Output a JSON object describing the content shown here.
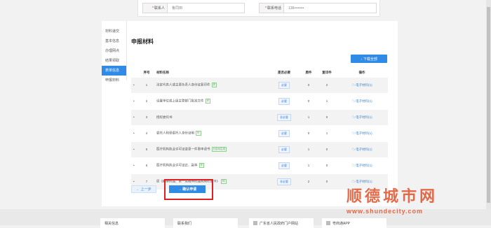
{
  "contact": {
    "person_label": "联系人",
    "person_value": "鲁同田",
    "phone_label": "联系电话",
    "phone_value": "138••••••••"
  },
  "steps": [
    {
      "label": "材料递交"
    },
    {
      "label": "基本信息"
    },
    {
      "label": "办理网点"
    },
    {
      "label": "结果领取"
    },
    {
      "label": "表单信息"
    },
    {
      "label": "申报材料"
    }
  ],
  "title": "申报材料",
  "download_all": "↓ 下载全部",
  "table": {
    "headers": [
      "序号",
      "材料名称",
      "是否必要",
      "原件",
      "复印件",
      "操作"
    ],
    "rows": [
      {
        "no": "1",
        "name": "法定代表人或主要负责人身份证复印件",
        "tag": "样",
        "required": "必要",
        "orig": "0",
        "copy": "2",
        "op": "☁ 电子材料(1)"
      },
      {
        "no": "2",
        "name": "设置单位或上级主管部门批准文件",
        "tag": "样",
        "required": "必要",
        "orig": "0",
        "copy": "1",
        "op": "☁ 电子材料(1)"
      },
      {
        "no": "3",
        "name": "授权委托书",
        "tag": "",
        "required": "非必要",
        "orig": "1",
        "copy": "0",
        "op": "☁ 电子材料(1)"
      },
      {
        "no": "4",
        "name": "委托人和受委托人身份证明",
        "tag": "样",
        "required": "必要",
        "orig": "0",
        "copy": "1",
        "op": "☁ 电子材料(1)"
      },
      {
        "no": "5",
        "name": "医疗机构执业许可证变更一件事申请书",
        "tag": "已自动生成",
        "required": "必要",
        "orig": "1",
        "copy": "0",
        "op": "☁ 电子材料(1)"
      },
      {
        "no": "6",
        "name": "医疗机构执业许可证正、副本",
        "tag": "样",
        "required": "必要",
        "orig": "1",
        "copy": "0",
        "op": "☁ 电子材料(1)"
      },
      {
        "no": "7",
        "name": "原《麻醉药品、第一类精神药品购用印鉴卡》",
        "tag": "样",
        "required": "非必要",
        "orig": "2",
        "copy": "0",
        "op": "☁ 电子材料(1)"
      }
    ]
  },
  "prev_label": "← 上一步",
  "confirm_label": "→ 确认申请",
  "footer": [
    "相关信息",
    "联系我们",
    "广东省人民政府门户网站",
    "粤商通APP"
  ],
  "watermark": {
    "cn": "顺德城市网",
    "url": "www.shundecity.com"
  }
}
